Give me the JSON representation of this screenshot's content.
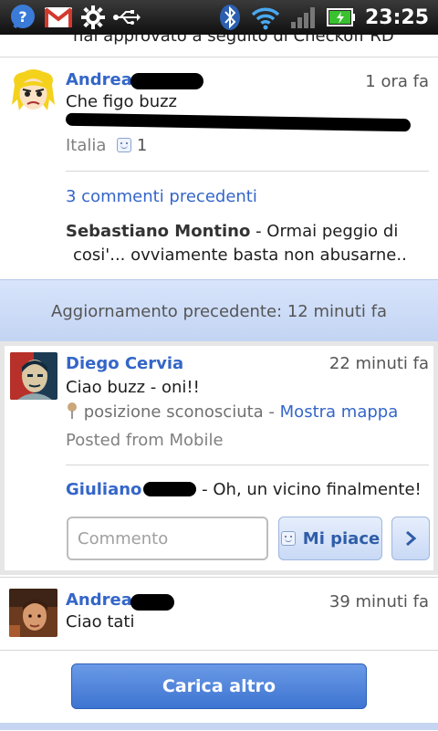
{
  "status_bar": {
    "time": "23:25",
    "icons": [
      "talk-icon",
      "gmail-icon",
      "gear-icon",
      "usb-icon",
      "bluetooth-icon",
      "wifi-icon",
      "signal-icon",
      "battery-charging-icon"
    ]
  },
  "top_cut_text": "hai approvato a seguito di Checkoff RD",
  "posts": [
    {
      "author": "Andrea",
      "time": "1 ora fa",
      "text": "Che figo buzz",
      "location_tail": "Italia",
      "likes": "1",
      "comments_link": "3 commenti precedenti",
      "comment": {
        "author": "Sebastiano Montino",
        "text_line1": " - Ormai peggio di",
        "text_line2": "cosi'... ovviamente basta non abusarne.."
      }
    }
  ],
  "update_bar": {
    "text": "Aggiornamento precedente: 12 minuti fa"
  },
  "post2": {
    "author": "Diego Cervia",
    "time": "22 minuti fa",
    "text": "Ciao buzz - oni!!",
    "location": "posizione sconosciuta",
    "location_sep": " - ",
    "map_link": "Mostra mappa",
    "posted_from": "Posted from Mobile",
    "comment_author": "Giuliano",
    "comment_text": " - Oh, un vicino finalmente!",
    "comment_placeholder": "Commento",
    "like_label": "Mi piace"
  },
  "post3": {
    "author": "Andrea",
    "time": "39 minuti fa",
    "text": "Ciao tati"
  },
  "load_more": "Carica altro",
  "colors": {
    "link": "#3466c8",
    "button_blue": "#3e74d1",
    "update_bar": "#c2d4f3"
  }
}
